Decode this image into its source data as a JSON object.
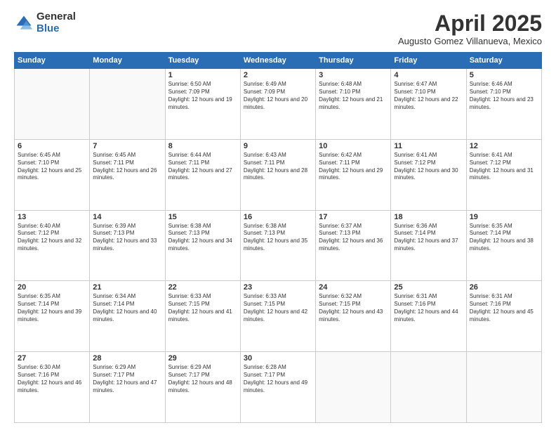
{
  "logo": {
    "general": "General",
    "blue": "Blue"
  },
  "title": "April 2025",
  "subtitle": "Augusto Gomez Villanueva, Mexico",
  "days_of_week": [
    "Sunday",
    "Monday",
    "Tuesday",
    "Wednesday",
    "Thursday",
    "Friday",
    "Saturday"
  ],
  "weeks": [
    [
      {
        "day": "",
        "info": ""
      },
      {
        "day": "",
        "info": ""
      },
      {
        "day": "1",
        "info": "Sunrise: 6:50 AM\nSunset: 7:09 PM\nDaylight: 12 hours and 19 minutes."
      },
      {
        "day": "2",
        "info": "Sunrise: 6:49 AM\nSunset: 7:09 PM\nDaylight: 12 hours and 20 minutes."
      },
      {
        "day": "3",
        "info": "Sunrise: 6:48 AM\nSunset: 7:10 PM\nDaylight: 12 hours and 21 minutes."
      },
      {
        "day": "4",
        "info": "Sunrise: 6:47 AM\nSunset: 7:10 PM\nDaylight: 12 hours and 22 minutes."
      },
      {
        "day": "5",
        "info": "Sunrise: 6:46 AM\nSunset: 7:10 PM\nDaylight: 12 hours and 23 minutes."
      }
    ],
    [
      {
        "day": "6",
        "info": "Sunrise: 6:45 AM\nSunset: 7:10 PM\nDaylight: 12 hours and 25 minutes."
      },
      {
        "day": "7",
        "info": "Sunrise: 6:45 AM\nSunset: 7:11 PM\nDaylight: 12 hours and 26 minutes."
      },
      {
        "day": "8",
        "info": "Sunrise: 6:44 AM\nSunset: 7:11 PM\nDaylight: 12 hours and 27 minutes."
      },
      {
        "day": "9",
        "info": "Sunrise: 6:43 AM\nSunset: 7:11 PM\nDaylight: 12 hours and 28 minutes."
      },
      {
        "day": "10",
        "info": "Sunrise: 6:42 AM\nSunset: 7:11 PM\nDaylight: 12 hours and 29 minutes."
      },
      {
        "day": "11",
        "info": "Sunrise: 6:41 AM\nSunset: 7:12 PM\nDaylight: 12 hours and 30 minutes."
      },
      {
        "day": "12",
        "info": "Sunrise: 6:41 AM\nSunset: 7:12 PM\nDaylight: 12 hours and 31 minutes."
      }
    ],
    [
      {
        "day": "13",
        "info": "Sunrise: 6:40 AM\nSunset: 7:12 PM\nDaylight: 12 hours and 32 minutes."
      },
      {
        "day": "14",
        "info": "Sunrise: 6:39 AM\nSunset: 7:13 PM\nDaylight: 12 hours and 33 minutes."
      },
      {
        "day": "15",
        "info": "Sunrise: 6:38 AM\nSunset: 7:13 PM\nDaylight: 12 hours and 34 minutes."
      },
      {
        "day": "16",
        "info": "Sunrise: 6:38 AM\nSunset: 7:13 PM\nDaylight: 12 hours and 35 minutes."
      },
      {
        "day": "17",
        "info": "Sunrise: 6:37 AM\nSunset: 7:13 PM\nDaylight: 12 hours and 36 minutes."
      },
      {
        "day": "18",
        "info": "Sunrise: 6:36 AM\nSunset: 7:14 PM\nDaylight: 12 hours and 37 minutes."
      },
      {
        "day": "19",
        "info": "Sunrise: 6:35 AM\nSunset: 7:14 PM\nDaylight: 12 hours and 38 minutes."
      }
    ],
    [
      {
        "day": "20",
        "info": "Sunrise: 6:35 AM\nSunset: 7:14 PM\nDaylight: 12 hours and 39 minutes."
      },
      {
        "day": "21",
        "info": "Sunrise: 6:34 AM\nSunset: 7:14 PM\nDaylight: 12 hours and 40 minutes."
      },
      {
        "day": "22",
        "info": "Sunrise: 6:33 AM\nSunset: 7:15 PM\nDaylight: 12 hours and 41 minutes."
      },
      {
        "day": "23",
        "info": "Sunrise: 6:33 AM\nSunset: 7:15 PM\nDaylight: 12 hours and 42 minutes."
      },
      {
        "day": "24",
        "info": "Sunrise: 6:32 AM\nSunset: 7:15 PM\nDaylight: 12 hours and 43 minutes."
      },
      {
        "day": "25",
        "info": "Sunrise: 6:31 AM\nSunset: 7:16 PM\nDaylight: 12 hours and 44 minutes."
      },
      {
        "day": "26",
        "info": "Sunrise: 6:31 AM\nSunset: 7:16 PM\nDaylight: 12 hours and 45 minutes."
      }
    ],
    [
      {
        "day": "27",
        "info": "Sunrise: 6:30 AM\nSunset: 7:16 PM\nDaylight: 12 hours and 46 minutes."
      },
      {
        "day": "28",
        "info": "Sunrise: 6:29 AM\nSunset: 7:17 PM\nDaylight: 12 hours and 47 minutes."
      },
      {
        "day": "29",
        "info": "Sunrise: 6:29 AM\nSunset: 7:17 PM\nDaylight: 12 hours and 48 minutes."
      },
      {
        "day": "30",
        "info": "Sunrise: 6:28 AM\nSunset: 7:17 PM\nDaylight: 12 hours and 49 minutes."
      },
      {
        "day": "",
        "info": ""
      },
      {
        "day": "",
        "info": ""
      },
      {
        "day": "",
        "info": ""
      }
    ]
  ]
}
